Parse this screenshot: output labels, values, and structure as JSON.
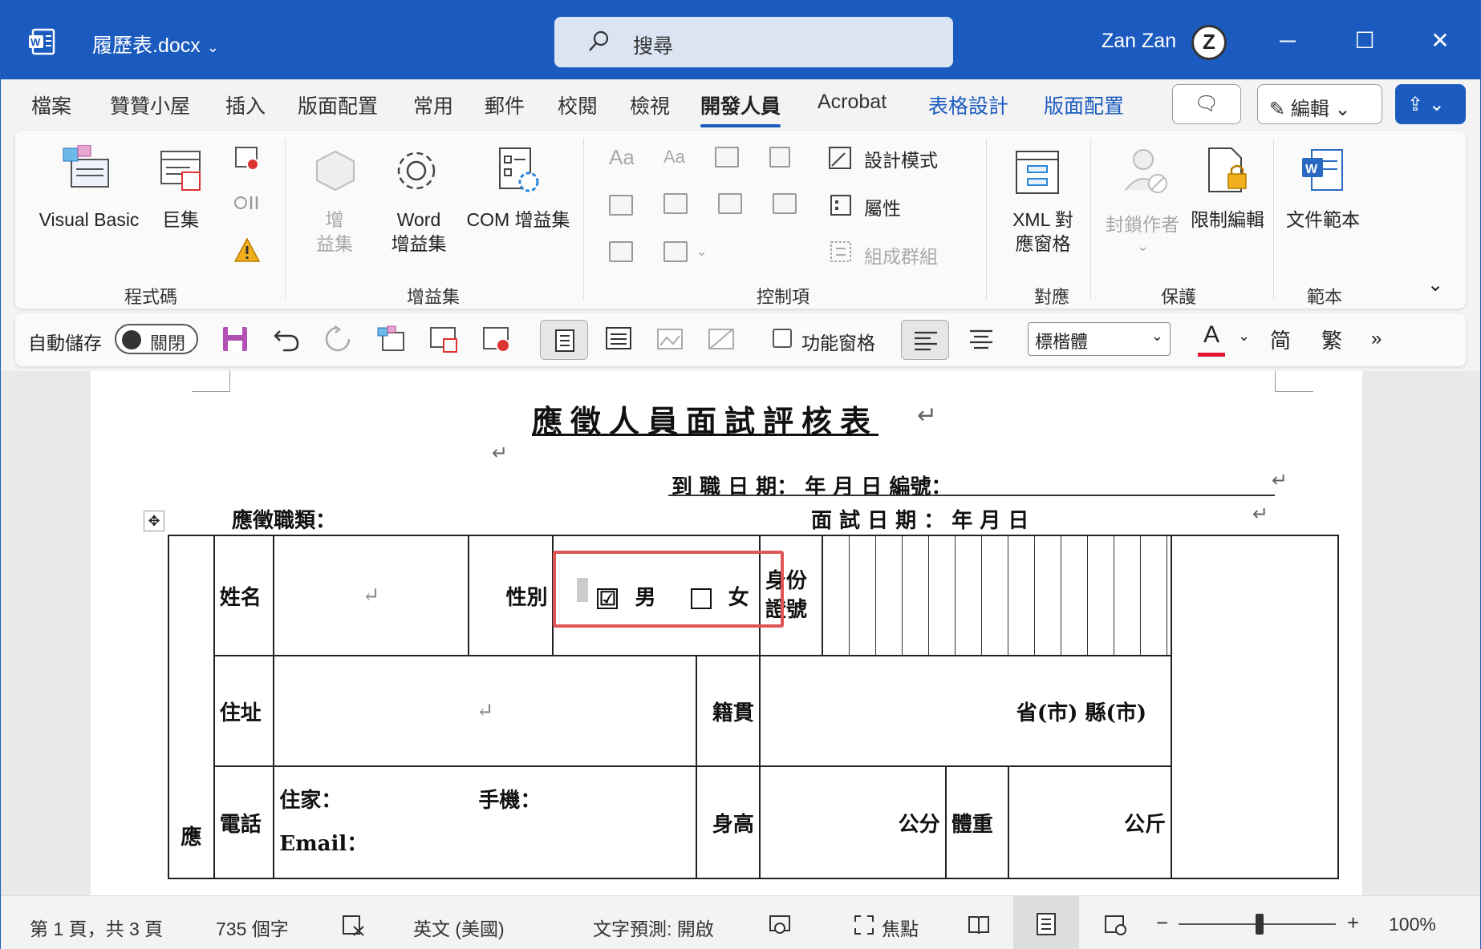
{
  "titlebar": {
    "filename": "履歷表.docx",
    "search_placeholder": "搜尋",
    "user_name": "Zan Zan",
    "avatar_letter": "Z",
    "minimize": "─",
    "maximize": "☐",
    "close": "✕"
  },
  "tabs": [
    "檔案",
    "贊贊小屋",
    "插入",
    "版面配置",
    "常用",
    "郵件",
    "校閱",
    "檢視",
    "開發人員",
    "Acrobat",
    "表格設計",
    "版面配置"
  ],
  "tab_buttons": {
    "comment": "🗨",
    "edit": "編輯",
    "share": "⇪"
  },
  "ribbon": {
    "code": {
      "visual_basic": "Visual Basic",
      "macro": "巨集",
      "group": "程式碼"
    },
    "addins": {
      "addin_1": "增",
      "addin_2": "益集",
      "word_addin_1": "Word",
      "word_addin_2": "增益集",
      "com_addin": "COM 增益集",
      "group": "增益集"
    },
    "controls": {
      "design_mode": "設計模式",
      "properties": "屬性",
      "group_btn": "組成群組",
      "group": "控制項",
      "aa1": "Aa",
      "aa2": "Aa"
    },
    "mapping": {
      "xml_1": "XML 對",
      "xml_2": "應窗格",
      "group": "對應"
    },
    "protect": {
      "block_author": "封鎖作者",
      "restrict": "限制編輯",
      "group": "保護"
    },
    "template": {
      "doc_template": "文件範本",
      "group": "範本"
    },
    "collapse": "⌄"
  },
  "qat": {
    "autosave": "自動儲存",
    "toggle_state": "關閉",
    "function_pane": "功能窗格",
    "font": "標楷體",
    "font_color_letter": "A",
    "simplified": "简",
    "traditional": "繁",
    "more": "»"
  },
  "document": {
    "title": "應徵人員面試評核表",
    "line1": "到 職 日 期：   年    月    日   編號：",
    "applied_job": "應徵職類：",
    "interview_date": "面 試 日 期 ：       年     月     日",
    "name": "姓名",
    "gender": "性別",
    "male": "男",
    "female": "女",
    "checked": "☑",
    "id_1": "身份",
    "id_2": "證號",
    "address": "住址",
    "native": "籍貫",
    "province": "省(市)      縣(市)",
    "phone": "電話",
    "home": "住家：",
    "mobile": "手機：",
    "email": "Email：",
    "height": "身高",
    "cm": "公分",
    "weight": "體重",
    "kg": "公斤",
    "side": "應",
    "pm": "↵"
  },
  "status": {
    "page": "第 1 頁，共 3 頁",
    "words": "735 個字",
    "language": "英文 (美國)",
    "prediction": "文字預測: 開啟",
    "focus": "焦點",
    "minus": "−",
    "plus": "+",
    "zoom": "100%"
  }
}
